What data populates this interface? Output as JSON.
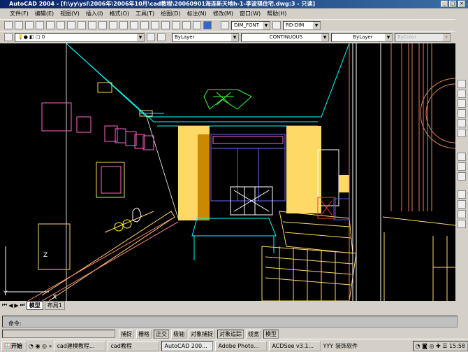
{
  "title": "AutoCAD 2004 - [f:\\yy\\ysl\\2006年\\2006年10月\\cad教程\\20060901海连新天地h-1-李波祺住宅.dwg:3 - 只读]",
  "menu": [
    "文件(F)",
    "编辑(E)",
    "视图(V)",
    "插入(I)",
    "格式(O)",
    "工具(T)",
    "绘图(D)",
    "标注(N)",
    "修改(M)",
    "窗口(W)",
    "帮助(H)"
  ],
  "toolbar": {
    "text_style": "DIM_FONT",
    "dim_style": "RD-DIM",
    "layer": "0",
    "color": "ByLayer",
    "linetype": "CONTINUOUS",
    "lineweight": "ByLayer",
    "plotstyle": "ByColor"
  },
  "tabs": [
    "模型",
    "布局1"
  ],
  "command": {
    "prompt": "命令:"
  },
  "status": [
    {
      "label": "捕捉",
      "on": false
    },
    {
      "label": "栅格",
      "on": false
    },
    {
      "label": "正交",
      "on": true
    },
    {
      "label": "极轴",
      "on": false
    },
    {
      "label": "对象捕捉",
      "on": false
    },
    {
      "label": "对象追踪",
      "on": true
    },
    {
      "label": "线宽",
      "on": false
    },
    {
      "label": "模型",
      "on": true
    }
  ],
  "taskbar": {
    "start": "开始",
    "items": [
      {
        "label": "cad建模教程...",
        "active": false
      },
      {
        "label": "cad教程",
        "active": false
      },
      {
        "label": "AutoCAD 200...",
        "active": true
      },
      {
        "label": "Adobe Photo...",
        "active": false
      },
      {
        "label": "ACDSee v3.1...",
        "active": false
      }
    ],
    "extra1": "YYY",
    "extra2": "装饰软件",
    "clock": "15:58"
  },
  "ucs": {
    "x": "X",
    "y": "Y",
    "z": "Z"
  },
  "colors": {
    "yellow": "#ffd966",
    "cyan": "#00ffff",
    "green": "#33ff33",
    "wood": "#e08060"
  }
}
